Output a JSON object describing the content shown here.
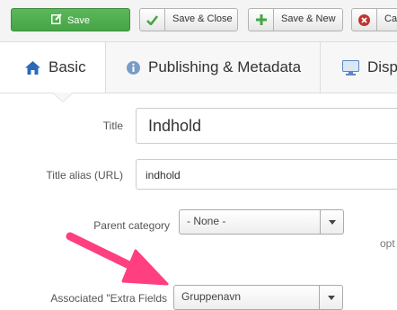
{
  "toolbar": {
    "save_label": "Save",
    "save_close_label": "Save & Close",
    "save_new_label": "Save & New",
    "cancel_label": "Can",
    "icons": {
      "save": "edit-icon",
      "save_close": "check-icon",
      "save_new": "plus-icon",
      "cancel": "cancel-circle-icon"
    },
    "colors": {
      "save_bg": "#46a546",
      "check": "#46a546",
      "plus": "#46a546",
      "cancel": "#bd362f"
    }
  },
  "tabs": [
    {
      "label": "Basic",
      "icon": "home-icon",
      "active": true
    },
    {
      "label": "Publishing & Metadata",
      "icon": "info-circle-icon",
      "active": false
    },
    {
      "label": "Disp",
      "icon": "monitor-icon",
      "active": false
    }
  ],
  "form": {
    "title": {
      "label": "Title",
      "value": "Indhold"
    },
    "alias": {
      "label": "Title alias (URL)",
      "value": "indhold"
    },
    "parent_category": {
      "label": "Parent category",
      "selected": "- None -"
    },
    "option_text": "opt",
    "extra_fields": {
      "label": "Associated \"Extra Fields",
      "selected": "Gruppenavn"
    }
  },
  "annotation": {
    "arrow_color": "#ff3f7f"
  }
}
